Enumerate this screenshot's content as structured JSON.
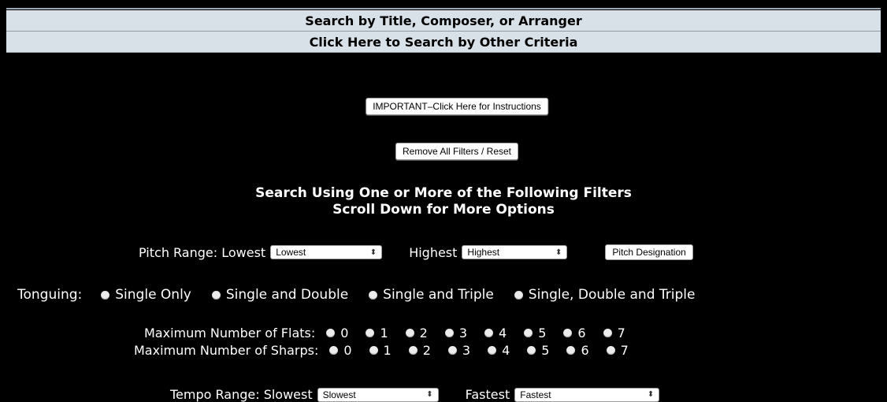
{
  "header": {
    "search_title": "Search by Title, Composer, or Arranger",
    "other_criteria": "Click Here to Search by Other Criteria"
  },
  "buttons": {
    "instructions": "IMPORTANT–Click Here for Instructions",
    "reset": "Remove All Filters / Reset",
    "pitch_designation": "Pitch Designation"
  },
  "filters": {
    "heading_line1": "Search Using One or More of the Following Filters",
    "heading_line2": "Scroll Down for More Options"
  },
  "pitch_range": {
    "label": "Pitch Range: Lowest",
    "lowest_value": "Lowest",
    "highest_label": "Highest",
    "highest_value": "Highest"
  },
  "tonguing": {
    "label": "Tonguing:",
    "options": [
      "Single Only",
      "Single and Double",
      "Single and Triple",
      "Single, Double and Triple"
    ]
  },
  "flats": {
    "label": "Maximum Number of Flats:",
    "options": [
      "0",
      "1",
      "2",
      "3",
      "4",
      "5",
      "6",
      "7"
    ]
  },
  "sharps": {
    "label": "Maximum Number of Sharps:",
    "options": [
      "0",
      "1",
      "2",
      "3",
      "4",
      "5",
      "6",
      "7"
    ]
  },
  "tempo_range": {
    "label": "Tempo Range: Slowest",
    "slowest_value": "Slowest",
    "fastest_label": "Fastest",
    "fastest_value": "Fastest"
  }
}
